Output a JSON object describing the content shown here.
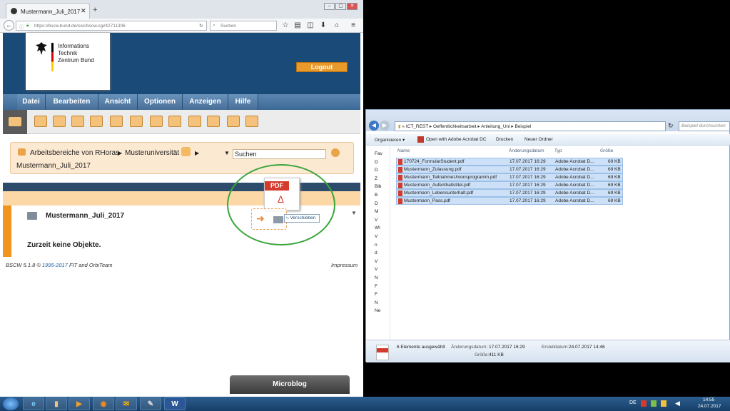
{
  "browser": {
    "tab_title": "Mustermann_Juli_2017",
    "new_tab": "+",
    "url": "https://bscw.bund.de/sec/bscw.cgi/42711306",
    "search_placeholder": "Suchen"
  },
  "site": {
    "logo_line1": "Informations",
    "logo_line2": "Technik",
    "logo_line3": "Zentrum Bund",
    "logout": "Logout",
    "menu": [
      "Datei",
      "Bearbeiten",
      "Ansicht",
      "Optionen",
      "Anzeigen",
      "Hilfe"
    ],
    "breadcrumb_root": "Arbeitsbereiche von RHoras",
    "breadcrumb_mid": "Musteruniversität",
    "breadcrumb_current": "Mustermann_Juli_2017",
    "search_label": "Suchen",
    "folder_title": "Mustermann_Juli_2017",
    "empty_text": "Zurzeit keine Objekte.",
    "footer_left_prefix": "BSCW 5.1.8 ©",
    "footer_years": "1995-2017",
    "footer_fit": "FIT",
    "footer_and": "and",
    "footer_orbi": "OrbiTeam",
    "footer_right": "Impressum",
    "microblog": "Microblog",
    "drag_pdf_badge": "PDF",
    "drag_move_label": "Verschieben"
  },
  "explorer": {
    "path_parts": [
      "ICT_REST",
      "Oeffentlichkeitsarbeit",
      "Anleitung_Uni",
      "Beispiel"
    ],
    "search_placeholder": "Beispiel durchsuchen",
    "commands": [
      "Organisieren",
      "Open with Adobe Acrobat DC",
      "Drucken",
      "Neuer Ordner"
    ],
    "nav_items": [
      "Fav",
      "D",
      "D",
      "Z",
      "Bib",
      "B",
      "D",
      "M",
      "V",
      "WI",
      "V",
      "n",
      "d",
      "V",
      "V",
      "N",
      "F",
      "F",
      "N",
      "Ne"
    ],
    "columns": [
      "Name",
      "Änderungsdatum",
      "Typ",
      "Größe"
    ],
    "files": [
      {
        "name": "170724_FormularStudent.pdf",
        "date": "17.07.2017 16:29",
        "type": "Adobe Acrobat D...",
        "size": "69 KB"
      },
      {
        "name": "Mustermann_Zulassung.pdf",
        "date": "17.07.2017 16:29",
        "type": "Adobe Acrobat D...",
        "size": "69 KB"
      },
      {
        "name": "Mustermann_TeilnahmeUnionsprogramm.pdf",
        "date": "17.07.2017 16:29",
        "type": "Adobe Acrobat D...",
        "size": "69 KB"
      },
      {
        "name": "Mustermann_Aufenthaltstitel.pdf",
        "date": "17.07.2017 16:29",
        "type": "Adobe Acrobat D...",
        "size": "69 KB"
      },
      {
        "name": "Mustermann_Lebensunterhalt.pdf",
        "date": "17.07.2017 16:29",
        "type": "Adobe Acrobat D...",
        "size": "69 KB"
      },
      {
        "name": "Mustermann_Pass.pdf",
        "date": "17.07.2017 16:29",
        "type": "Adobe Acrobat D...",
        "size": "69 KB"
      }
    ],
    "status_selected": "6 Elemente ausgewählt",
    "status_changed_label": "Änderungsdatum:",
    "status_changed": "17.07.2017 16:29",
    "status_created_label": "Erstelldatum:",
    "status_created": "24.07.2017 14:46",
    "status_size_label": "Größe:",
    "status_size": "411 KB"
  },
  "taskbar": {
    "lang": "DE",
    "time": "14:55",
    "date": "24.07.2017",
    "word_label": "W"
  },
  "colors": {
    "banner": "#1a4a78",
    "accent_orange": "#f0931f",
    "highlight_circle": "#3aa53a"
  }
}
